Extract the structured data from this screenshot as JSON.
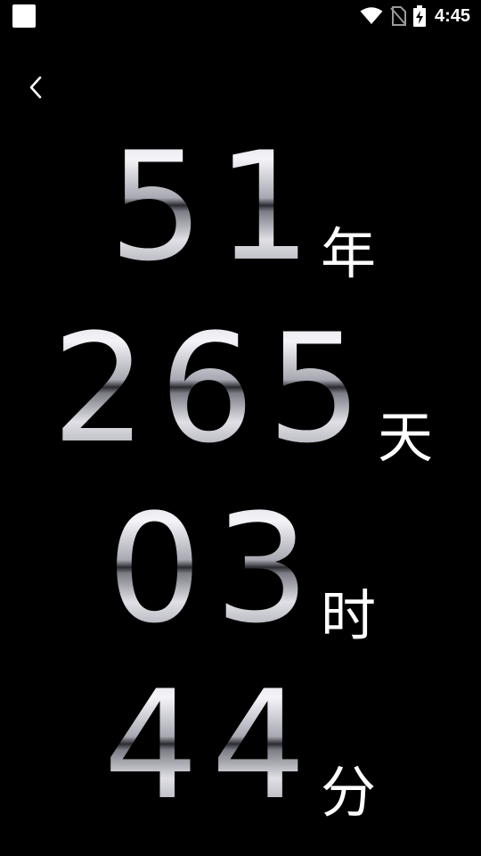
{
  "status_bar": {
    "time": "4:45",
    "icons": [
      "app-notification-icon",
      "wifi-icon",
      "no-sim-icon",
      "battery-charging-icon"
    ]
  },
  "navigation": {
    "back_icon": "chevron-left-icon"
  },
  "countdown": {
    "years": {
      "value": "51",
      "unit": "年"
    },
    "days": {
      "value": "265",
      "unit": "天"
    },
    "hours": {
      "value": "03",
      "unit": "时"
    },
    "minutes": {
      "value": "44",
      "unit": "分"
    }
  },
  "colors": {
    "background": "#000000",
    "text": "#ffffff",
    "digit_metal_light": "#f4f4f8",
    "digit_metal_dark": "#2a2a30"
  }
}
